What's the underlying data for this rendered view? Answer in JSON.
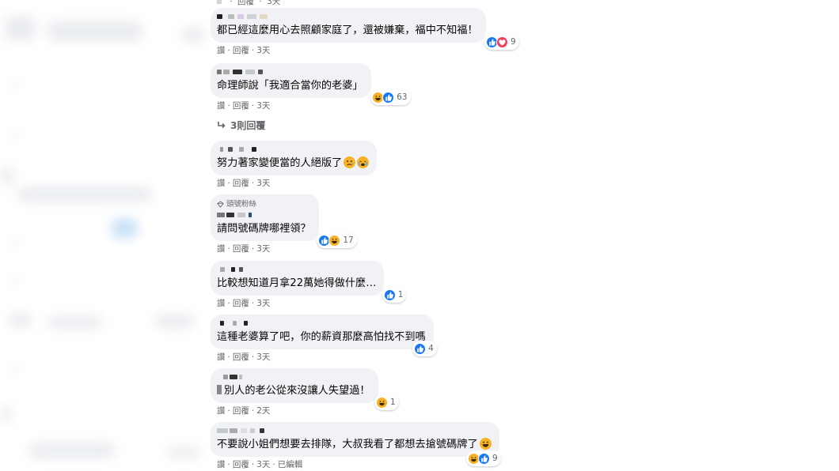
{
  "colors": {
    "bubble": "#f0f2f5",
    "text": "#050505",
    "meta": "#65676b",
    "like": "#1877f2",
    "love": "#f33e58",
    "haha": "#f7b125"
  },
  "top_meta": {
    "reply": "回覆",
    "time": "3天"
  },
  "comments": [
    {
      "text": "都已經這麼用心去照顧家庭了，還被嫌棄，福中不知福！",
      "reactions": [
        "like-icon",
        "love-icon"
      ],
      "count": "9",
      "read": "讚",
      "reply": "回覆",
      "time": "3天"
    },
    {
      "text": "命理師說「我適合當你的老婆」",
      "reactions": [
        "haha-icon",
        "like-icon"
      ],
      "count": "63",
      "read": "讚",
      "reply": "回覆",
      "time": "3天"
    },
    {
      "text": "努力著家變便當的人絕版了",
      "reactions": [],
      "count": "",
      "read": "讚",
      "reply": "回覆",
      "time": "3天"
    },
    {
      "badge": "頭號粉絲",
      "text": "請問號碼牌哪裡領？",
      "reactions": [
        "like-icon",
        "haha-icon"
      ],
      "count": "17",
      "read": "讚",
      "reply": "回覆",
      "time": "3天"
    },
    {
      "text": "比較想知道月拿22萬她得做什麼…",
      "reactions": [
        "like-icon"
      ],
      "count": "1",
      "read": "讚",
      "reply": "回覆",
      "time": "3天"
    },
    {
      "text": "這種老婆算了吧，你的薪資那麼高怕找不到嗎",
      "reactions": [
        "like-icon"
      ],
      "count": "4",
      "read": "讚",
      "reply": "回覆",
      "time": "3天"
    },
    {
      "text": "別人的老公從來沒讓人失望過！",
      "reactions": [
        "haha-icon"
      ],
      "count": "1",
      "read": "讚",
      "reply": "回覆",
      "time": "2天"
    },
    {
      "text": "不要說小姐們想要去排隊，大叔我看了都想去搶號碼牌了",
      "reactions": [
        "haha-icon",
        "like-icon"
      ],
      "count": "9",
      "read": "讚",
      "reply": "回覆",
      "time": "3天",
      "edited": "已編輯"
    }
  ],
  "replies_link": "3則回覆"
}
